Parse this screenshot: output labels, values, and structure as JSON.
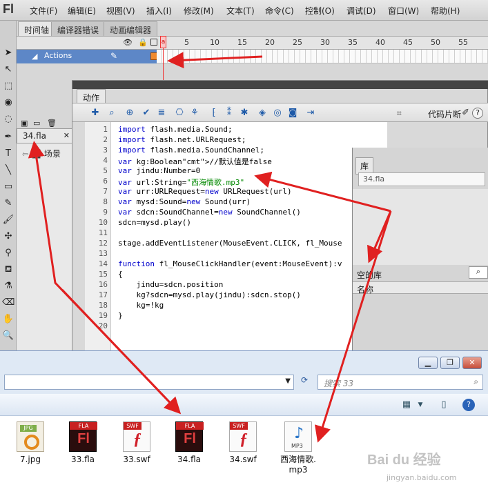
{
  "app": {
    "logo": "Fl",
    "menus": [
      "文件(F)",
      "编辑(E)",
      "视图(V)",
      "插入(I)",
      "修改(M)",
      "文本(T)",
      "命令(C)",
      "控制(O)",
      "调试(D)",
      "窗口(W)",
      "帮助(H)"
    ]
  },
  "timeline": {
    "tabs": [
      "时间轴",
      "编译器错误",
      "动画编辑器"
    ],
    "frame_numbers": [
      "1",
      "5",
      "10",
      "15",
      "20",
      "25",
      "30",
      "35",
      "40",
      "45",
      "50",
      "55"
    ],
    "layer": "Actions",
    "keyframe_marker": "a"
  },
  "document": {
    "tab": "34.fla",
    "scene": "场景"
  },
  "actions_panel": {
    "tab": "动作",
    "snippets": "代码片断",
    "help": "?",
    "line_numbers": [
      "1",
      "2",
      "3",
      "4",
      "5",
      "6",
      "7",
      "8",
      "9",
      "10",
      "11",
      "12",
      "13",
      "14",
      "15",
      "16",
      "17",
      "18",
      "19",
      "20"
    ],
    "code": [
      "import flash.media.Sound;",
      "import flash.net.URLRequest;",
      "import flash.media.SoundChannel;",
      "var kg:Boolean//默认值是false",
      "var jindu:Number=0",
      "var url:String=\"西海情歌.mp3\"",
      "var urr:URLRequest=new URLRequest(url)",
      "var mysd:Sound=new Sound(urr)",
      "var sdcn:SoundChannel=new SoundChannel()",
      "sdcn=mysd.play()",
      "",
      "stage.addEventListener(MouseEvent.CLICK, fl_Mouse",
      "",
      "function fl_MouseClickHandler(event:MouseEvent):v",
      "{",
      "    jindu=sdcn.position",
      "    kg?sdcn=mysd.play(jindu):sdcn.stop()",
      "    kg=!kg",
      "}",
      ""
    ]
  },
  "library": {
    "tab": "库",
    "document": "34.fla",
    "count": "空的库",
    "column": "名称"
  },
  "explorer": {
    "search_placeholder": "搜索 33",
    "files": [
      {
        "name": "7.jpg",
        "type": "JPG"
      },
      {
        "name": "33.fla",
        "type": "FLA"
      },
      {
        "name": "33.swf",
        "type": "SWF"
      },
      {
        "name": "34.fla",
        "type": "FLA"
      },
      {
        "name": "34.swf",
        "type": "SWF"
      },
      {
        "name": "西海情歌.\nmp3",
        "type": "MP3"
      }
    ]
  },
  "watermark": {
    "brand": "Bai du 经验",
    "url": "jingyan.baidu.com"
  },
  "colors": {
    "annotation_arrow": "#e02020",
    "selected_layer": "#5d87c7"
  }
}
